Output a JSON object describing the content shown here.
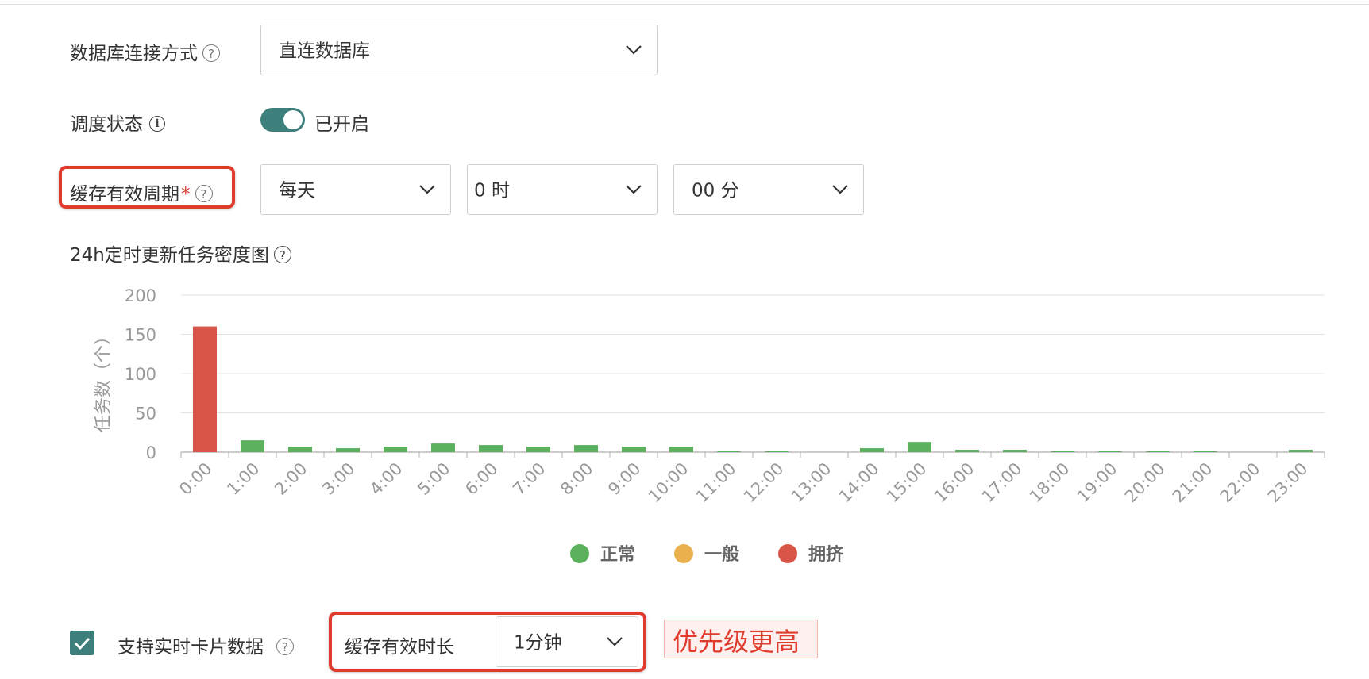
{
  "form": {
    "db_connection": {
      "label": "数据库连接方式",
      "value": "直连数据库"
    },
    "schedule_status": {
      "label": "调度状态",
      "value": "已开启",
      "enabled": true
    },
    "cache_period": {
      "label": "缓存有效周期",
      "required_mark": "*",
      "frequency": "每天",
      "hour": "0 时",
      "minute": "00 分"
    },
    "chart_title": "24h定时更新任务密度图",
    "realtime": {
      "label": "支持实时卡片数据",
      "checked": true,
      "duration_label": "缓存有效时长",
      "duration_value": "1分钟"
    },
    "priority_note": "优先级更高"
  },
  "icons": {
    "help": "question-circle-icon",
    "info": "info-circle-icon",
    "chevron": "chevron-down-icon",
    "check": "check-icon"
  },
  "colors": {
    "accent": "#3d7f7b",
    "normal": "#5cb15f",
    "medium": "#eab04e",
    "congested": "#d85446",
    "annotation": "#e03c2e"
  },
  "chart_data": {
    "type": "bar",
    "ylabel": "任务数（个）",
    "ylim": [
      0,
      200
    ],
    "yticks": [
      0,
      50,
      100,
      150,
      200
    ],
    "categories": [
      "0:00",
      "1:00",
      "2:00",
      "3:00",
      "4:00",
      "5:00",
      "6:00",
      "7:00",
      "8:00",
      "9:00",
      "10:00",
      "11:00",
      "12:00",
      "13:00",
      "14:00",
      "15:00",
      "16:00",
      "17:00",
      "18:00",
      "19:00",
      "20:00",
      "21:00",
      "22:00",
      "23:00"
    ],
    "values": [
      160,
      15,
      7,
      5,
      7,
      11,
      9,
      7,
      9,
      7,
      7,
      1,
      1,
      0,
      5,
      13,
      3,
      3,
      1,
      1,
      1,
      1,
      0,
      3
    ],
    "status": [
      "拥挤",
      "正常",
      "正常",
      "正常",
      "正常",
      "正常",
      "正常",
      "正常",
      "正常",
      "正常",
      "正常",
      "正常",
      "正常",
      "正常",
      "正常",
      "正常",
      "正常",
      "正常",
      "正常",
      "正常",
      "正常",
      "正常",
      "正常",
      "正常"
    ],
    "legend": [
      {
        "name": "正常",
        "color": "#5cb15f"
      },
      {
        "name": "一般",
        "color": "#eab04e"
      },
      {
        "name": "拥挤",
        "color": "#d85446"
      }
    ],
    "legend_position": "bottom",
    "grid": true
  }
}
